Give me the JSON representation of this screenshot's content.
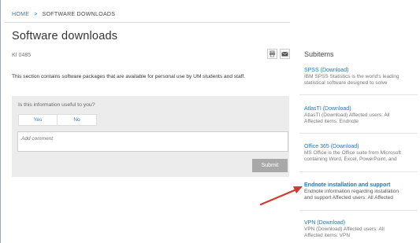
{
  "breadcrumb": {
    "home": "HOME",
    "separator": ">",
    "current": "SOFTWARE DOWNLOADS"
  },
  "page": {
    "title": "Software downloads",
    "ki_id": "KI 0485",
    "description": "This section contains software packages that are available for personal use by UM students and staff."
  },
  "toolbar": {
    "print_icon": "print-icon",
    "mail_icon": "mail-icon"
  },
  "feedback": {
    "question": "Is this information useful to you?",
    "yes_label": "Yes",
    "no_label": "No",
    "comment_placeholder": "Add comment",
    "submit_label": "Submit"
  },
  "sidebar": {
    "title": "Subitems",
    "items": [
      {
        "title": "SPSS (Download)",
        "desc1": "IBM SPSS Statistics is the world's leading",
        "desc2": "statistical software designed to solve"
      },
      {
        "title": "AtlasTI (Download)",
        "desc1": "AtlasTI (Download) Affected users: All",
        "desc2": "Affected items: Endnote"
      },
      {
        "title": "Office 365 (Download)",
        "desc1": "MS Office is the Office suite from Microsoft",
        "desc2": "containing Word, Excel, PowerPoint, and"
      },
      {
        "title": "Endnote installation and support",
        "desc1": "Endnote information regarding installation",
        "desc2": "and support Affected users: All Affected"
      },
      {
        "title": "VPN (Download)",
        "desc1": "VPN (Download) Affected users: All",
        "desc2": "Affected items: VPN"
      }
    ]
  },
  "colors": {
    "link": "#1f77b4",
    "arrow": "#d23a2e",
    "panel": "#ececec",
    "submit": "#a8a8a8"
  }
}
